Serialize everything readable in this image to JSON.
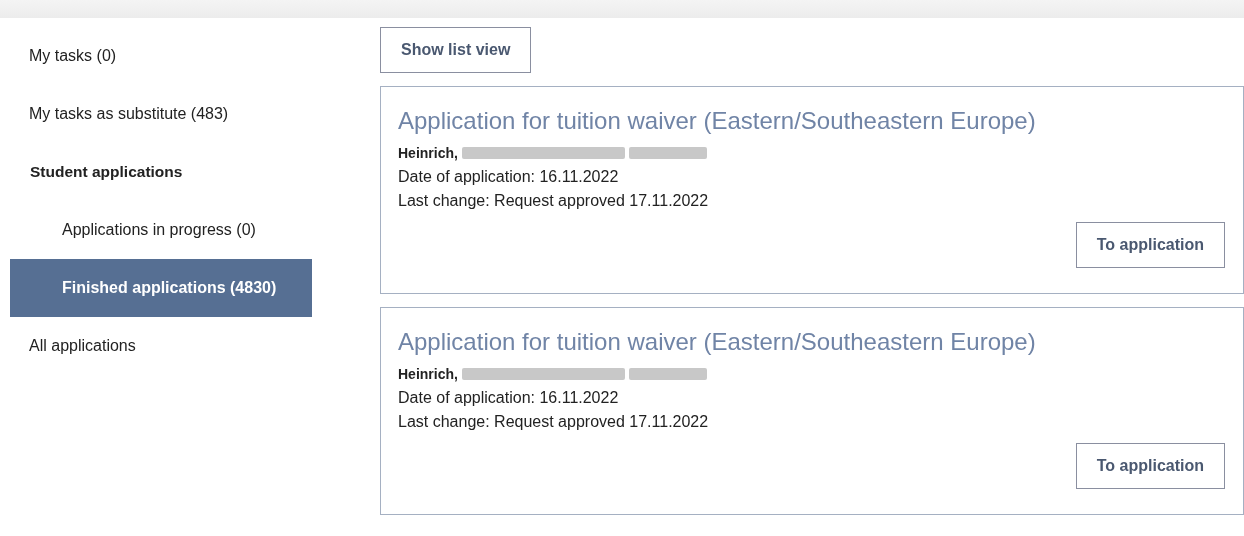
{
  "sidebar": {
    "items": [
      {
        "label": "My tasks (0)",
        "selected": false
      },
      {
        "label": "My tasks as substitute (483)",
        "selected": false
      },
      {
        "label": "Student applications",
        "kind": "heading",
        "selected": false,
        "children": [
          {
            "label": "Applications in progress (0)",
            "selected": false
          },
          {
            "label": "Finished applications (4830)",
            "selected": true
          }
        ]
      },
      {
        "label": "All applications",
        "selected": false
      }
    ]
  },
  "view_button": "Show list view",
  "applications": [
    {
      "title": "Application for tuition waiver (Eastern/Southeastern Europe)",
      "applicant": "Heinrich,",
      "redacted": true,
      "date": "Date of application: 16.11.2022",
      "last_change": "Last change: Request approved 17.11.2022",
      "button": "To application"
    },
    {
      "title": "Application for tuition waiver (Eastern/Southeastern Europe)",
      "applicant": "Heinrich,",
      "redacted": true,
      "date": "Date of application: 16.11.2022",
      "last_change": "Last change: Request approved 17.11.2022",
      "button": "To application"
    }
  ]
}
